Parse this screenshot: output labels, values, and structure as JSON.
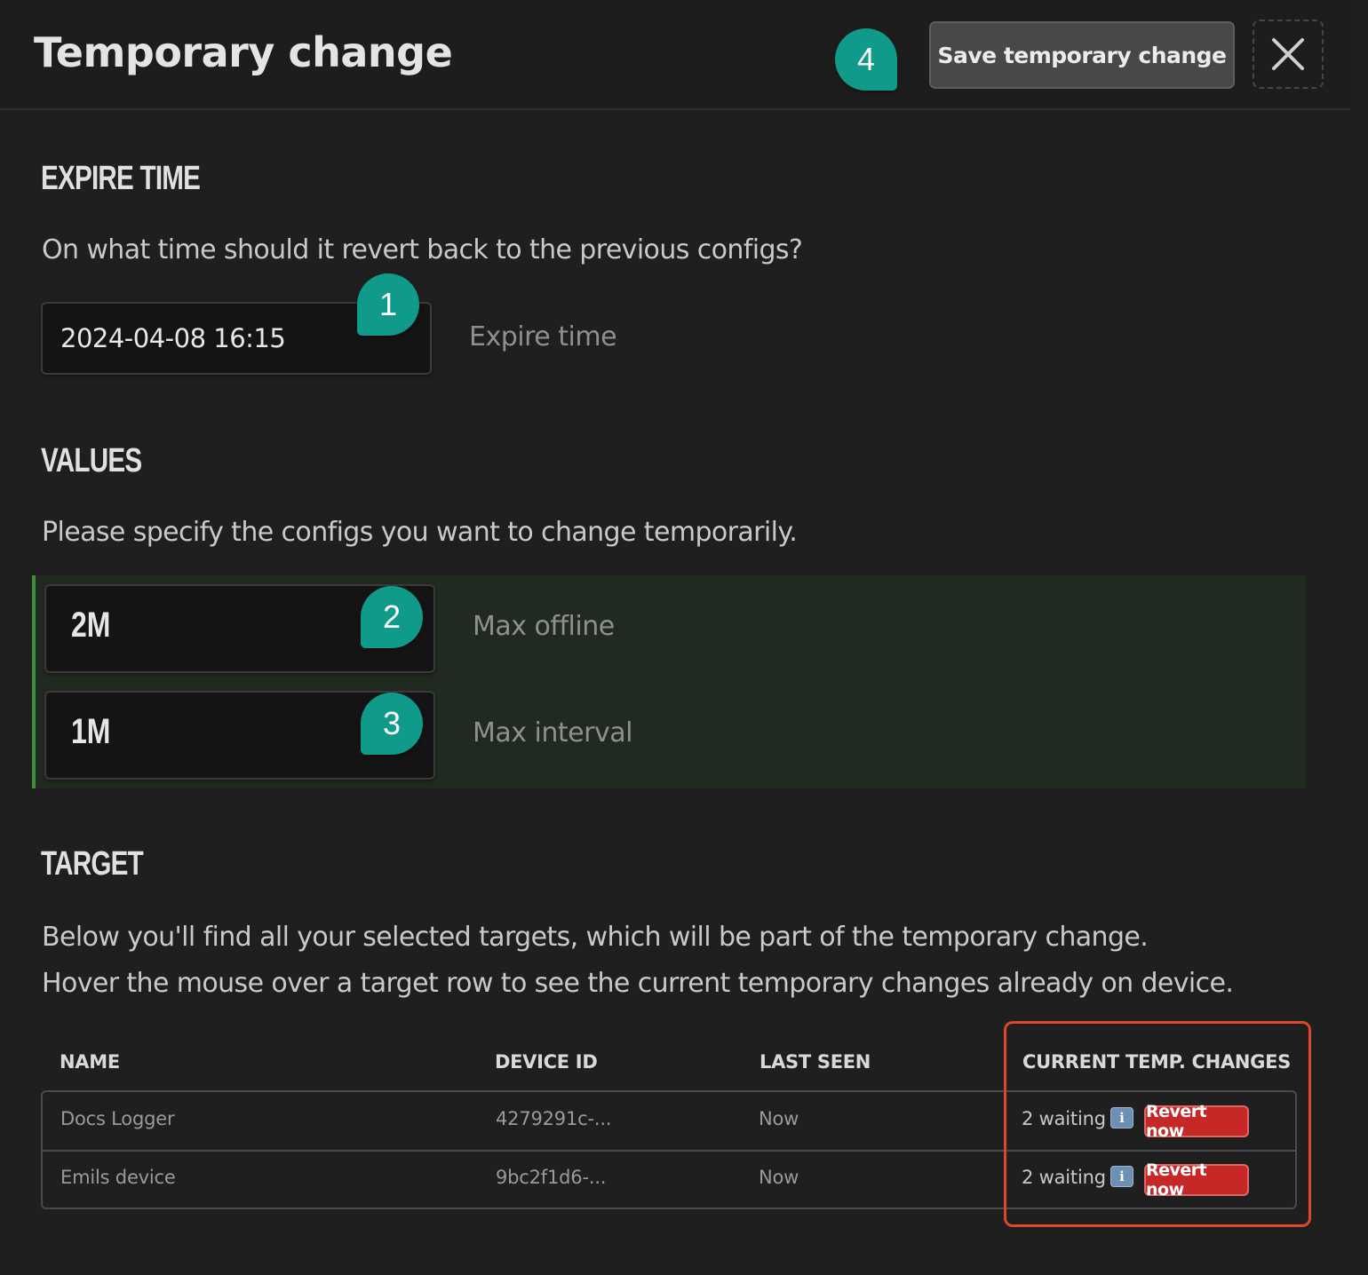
{
  "header": {
    "title": "Temporary change",
    "save_label": "Save temporary change",
    "close_icon": "close-icon"
  },
  "markers": [
    "1",
    "2",
    "3",
    "4"
  ],
  "expire": {
    "section_title": "EXPIRE TIME",
    "description": "On what time should it revert back to the previous configs?",
    "value": "2024-04-08 16:15",
    "label": "Expire time"
  },
  "values": {
    "section_title": "VALUES",
    "description": "Please specify the configs you want to change temporarily.",
    "fields": [
      {
        "value": "2M",
        "label": "Max offline"
      },
      {
        "value": "1M",
        "label": "Max interval"
      }
    ]
  },
  "target": {
    "section_title": "TARGET",
    "description_1": "Below you'll find all your selected targets, which will be part of the temporary change.",
    "description_2": "Hover the mouse over a target row to see the current temporary changes already on device.",
    "columns": [
      "NAME",
      "DEVICE ID",
      "LAST SEEN",
      "CURRENT TEMP. CHANGES"
    ],
    "rows": [
      {
        "name": "Docs Logger",
        "device_id": "4279291c-...",
        "last_seen": "Now",
        "changes": "2 waiting",
        "info_icon": "i",
        "action": "Revert now"
      },
      {
        "name": "Emils device",
        "device_id": "9bc2f1d6-...",
        "last_seen": "Now",
        "changes": "2 waiting",
        "info_icon": "i",
        "action": "Revert now"
      }
    ]
  },
  "colors": {
    "marker": "#0f9a8a",
    "revert": "#c62828",
    "highlight": "#e0462a",
    "values_accent": "#3f8f3a"
  }
}
